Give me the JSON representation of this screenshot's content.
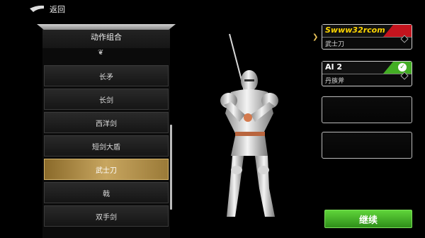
{
  "topbar": {
    "back_label": "返回"
  },
  "list": {
    "header": "动作组合",
    "items": [
      "长矛",
      "长剑",
      "西洋剑",
      "短剑大盾",
      "武士刀",
      "戟",
      "双手剑"
    ],
    "selected": "武士刀"
  },
  "players": [
    {
      "name": "Swww32rcom",
      "weapon": "武士刀",
      "accent": "#c4141e",
      "name_color": "#ffd600"
    },
    {
      "name": "AI 2",
      "weapon": "丹族斧",
      "accent": "#43ad24",
      "name_color": "#ffffff"
    }
  ],
  "continue_label": "继续",
  "colors": {
    "gold": "#c8a660",
    "green": "#43ad24",
    "red": "#c4141e"
  }
}
